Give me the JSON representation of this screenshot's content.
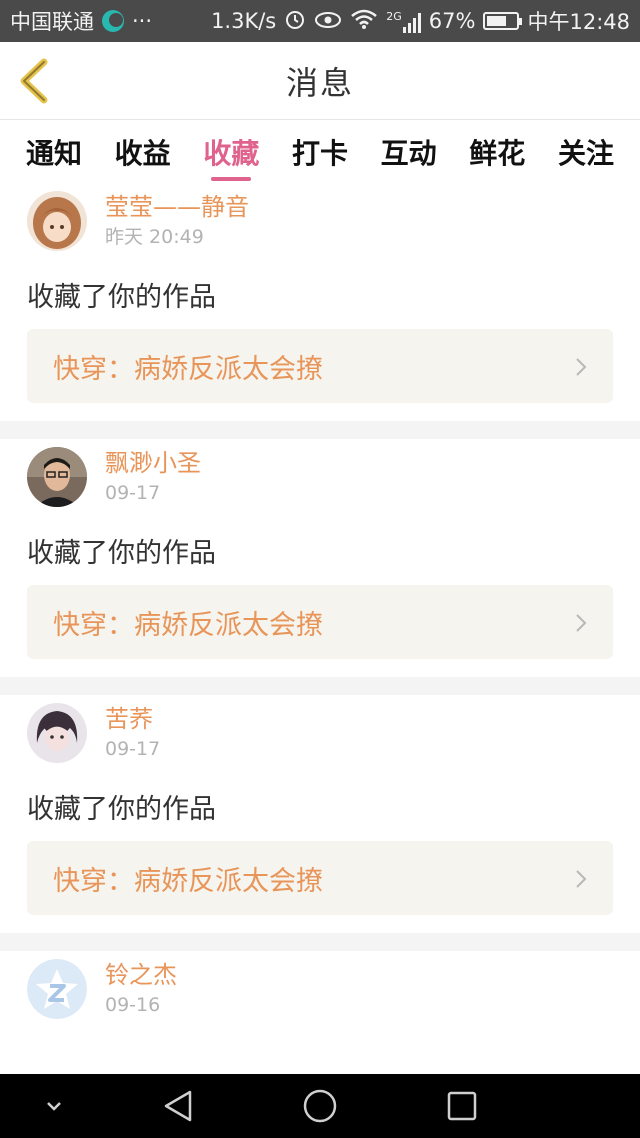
{
  "status_bar": {
    "carrier": "中国联通",
    "dots": "···",
    "speed": "1.3K/s",
    "network": "2G",
    "battery_percent": "67%",
    "time": "中午12:48",
    "battery_level": 0.67
  },
  "header": {
    "title": "消息",
    "back_icon": "chevron-left-icon"
  },
  "tabs": [
    {
      "label": "通知",
      "active": false
    },
    {
      "label": "收益",
      "active": false
    },
    {
      "label": "收藏",
      "active": true
    },
    {
      "label": "打卡",
      "active": false
    },
    {
      "label": "互动",
      "active": false
    },
    {
      "label": "鲜花",
      "active": false
    },
    {
      "label": "关注",
      "active": false
    }
  ],
  "feed": [
    {
      "name": "莹莹——静音",
      "time": "昨天 20:49",
      "action": "收藏了你的作品",
      "work": "快穿：病娇反派太会撩"
    },
    {
      "name": "飘渺小圣",
      "time": "09-17",
      "action": "收藏了你的作品",
      "work": "快穿：病娇反派太会撩"
    },
    {
      "name": "苦荞",
      "time": "09-17",
      "action": "收藏了你的作品",
      "work": "快穿：病娇反派太会撩"
    },
    {
      "name": "铃之杰",
      "time": "09-16",
      "action": "",
      "work": ""
    }
  ],
  "colors": {
    "accent_pink": "#e0638d",
    "name_orange": "#e8955a",
    "work_bg": "#f6f4ee"
  },
  "nav_bar": {
    "icons": [
      "chevron-down-icon",
      "back-triangle-icon",
      "home-circle-icon",
      "recent-square-icon"
    ]
  }
}
